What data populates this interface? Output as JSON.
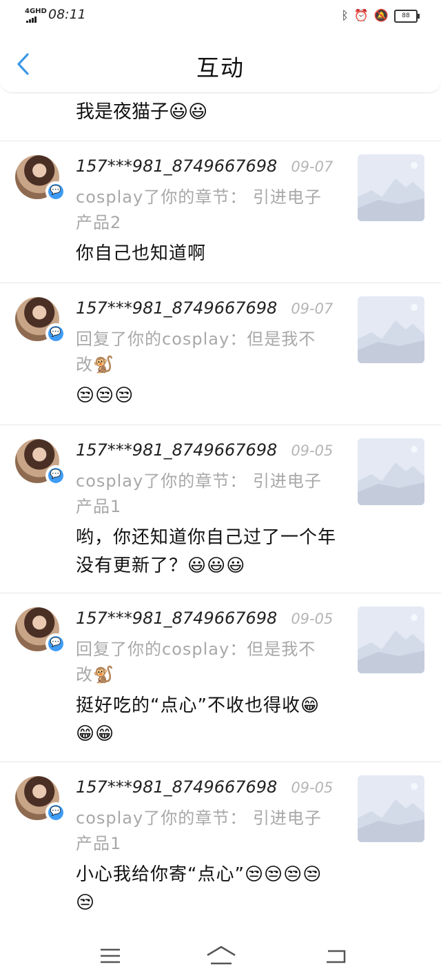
{
  "status": {
    "network": "4GHD",
    "time": "08:11",
    "battery": "88"
  },
  "header": {
    "title": "互动"
  },
  "previous_message": "我是夜猫子😃😃",
  "items": [
    {
      "user": "157***981_8749667698",
      "date": "09-07",
      "subtitle": "cosplay了你的章节：  引进电子产品2",
      "message": "你自己也知道啊"
    },
    {
      "user": "157***981_8749667698",
      "date": "09-07",
      "subtitle": "回复了你的cosplay：但是我不改🐒",
      "message": "😒😒😒"
    },
    {
      "user": "157***981_8749667698",
      "date": "09-05",
      "subtitle": "cosplay了你的章节：  引进电子产品1",
      "message": "哟，你还知道你自己过了一个年没有更新了？😃😃😃"
    },
    {
      "user": "157***981_8749667698",
      "date": "09-05",
      "subtitle": "回复了你的cosplay：但是我不改🐒",
      "message": "挺好吃的“点心”不收也得收😁😁😁"
    },
    {
      "user": "157***981_8749667698",
      "date": "09-05",
      "subtitle": "cosplay了你的章节：  引进电子产品1",
      "message": "小心我给你寄“点心”😒😒😒😒😒"
    }
  ],
  "navbar": [
    "menu-icon",
    "home-icon",
    "back-icon"
  ]
}
